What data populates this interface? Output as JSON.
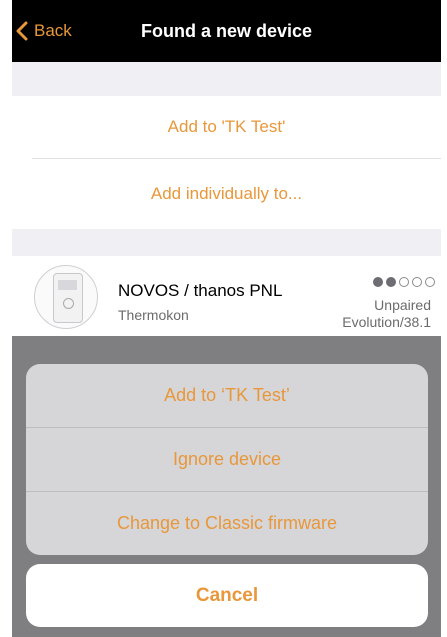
{
  "nav": {
    "back_label": "Back",
    "title": "Found a new device"
  },
  "options": {
    "add_to_group": "Add to 'TK Test'",
    "add_individually": "Add individually to..."
  },
  "device": {
    "name": "NOVOS / thanos PNL",
    "manufacturer": "Thermokon",
    "status": "Unpaired",
    "firmware": "Evolution/38.1",
    "signal_strength": 2,
    "signal_max": 5
  },
  "action_sheet": {
    "add_to_group": "Add to ‘TK Test’",
    "ignore": "Ignore device",
    "change_firmware": "Change to Classic firmware",
    "cancel": "Cancel"
  },
  "colors": {
    "accent": "#e8973a",
    "nav_background": "#000000",
    "group_background": "#efeff4",
    "dim_overlay": "#7f7f81"
  },
  "icons": {
    "back": "chevron-left-icon",
    "signal": "signal-dots-icon",
    "device": "device-thumbnail"
  }
}
